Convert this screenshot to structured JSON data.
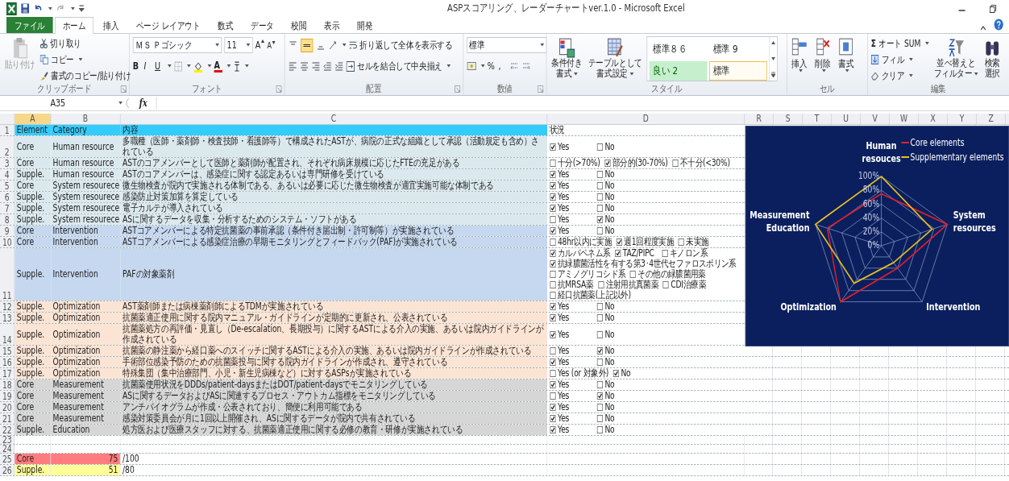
{
  "window": {
    "title": "ASPスコアリング、レーダーチャートver.1.0 - Microsoft Excel"
  },
  "tabs": [
    {
      "label": "ファイル",
      "kind": "file",
      "selected": false
    },
    {
      "label": "ホーム",
      "kind": "tab",
      "selected": true
    },
    {
      "label": "挿入",
      "kind": "tab",
      "selected": false
    },
    {
      "label": "ページ レイアウト",
      "kind": "tab",
      "selected": false
    },
    {
      "label": "数式",
      "kind": "tab",
      "selected": false
    },
    {
      "label": "データ",
      "kind": "tab",
      "selected": false
    },
    {
      "label": "校閲",
      "kind": "tab",
      "selected": false
    },
    {
      "label": "表示",
      "kind": "tab",
      "selected": false
    },
    {
      "label": "開発",
      "kind": "tab",
      "selected": false
    }
  ],
  "ribbon": {
    "clipboard": {
      "paste": "貼り付け",
      "cut": "切り取り",
      "copy": "コピー",
      "format_painter": "書式のコピー/貼り付け",
      "label": "クリップボード"
    },
    "font": {
      "name": "ＭＳ Ｐゴシック",
      "size": "11",
      "grow": "A",
      "shrink": "A",
      "bold": "B",
      "italic": "I",
      "underline": "U",
      "font_color": "A",
      "label": "フォント"
    },
    "alignment": {
      "wrap": "折り返して全体を表示する",
      "merge": "セルを結合して中央揃え",
      "label": "配置"
    },
    "number": {
      "format": "標準",
      "percent": "%",
      "comma": ",",
      "label": "数値"
    },
    "styles": {
      "conditional": [
        "条件付き",
        "書式"
      ],
      "table": [
        "テーブルとして",
        "書式設定"
      ],
      "gallery": [
        {
          "label": "標準８６",
          "kind": "plain",
          "selected": false
        },
        {
          "label": "標準 9",
          "kind": "plain",
          "selected": false
        },
        {
          "label": "良い 2",
          "kind": "good",
          "selected": false
        },
        {
          "label": "標準",
          "kind": "plain",
          "selected": true
        }
      ],
      "label": "スタイル"
    },
    "cells": {
      "buttons": [
        "挿入",
        "削除",
        "書式"
      ],
      "label": "セル"
    },
    "editing": {
      "sigma": "Σ",
      "autosum": "オート SUM",
      "fill": "フィル",
      "clear": "クリア",
      "sort": [
        "並べ替えと",
        "フィルター"
      ],
      "find": [
        "検索",
        "選択"
      ],
      "label": "編集"
    }
  },
  "formula_bar": {
    "name_box": "A35",
    "fx": "fx"
  },
  "sheet": {
    "columns": [
      {
        "label": "A",
        "selected": true
      },
      {
        "label": "B",
        "selected": false
      },
      {
        "label": "C",
        "selected": false
      },
      {
        "label": "D",
        "selected": false
      },
      {
        "label": "R",
        "selected": false
      },
      {
        "label": "S",
        "selected": false
      },
      {
        "label": "T",
        "selected": false
      },
      {
        "label": "U",
        "selected": false
      },
      {
        "label": "V",
        "selected": false
      },
      {
        "label": "W",
        "selected": false
      },
      {
        "label": "X",
        "selected": false
      },
      {
        "label": "Y",
        "selected": false
      },
      {
        "label": "Z",
        "selected": false
      }
    ],
    "rows": [
      {
        "number": "1",
        "kind": "header",
        "element": "Element",
        "category": "Category",
        "content": "内容",
        "status": "状況"
      },
      {
        "number": "2",
        "kind": "item",
        "color": "#dbe9ef",
        "element": "Core",
        "category": "Human resource",
        "content": "多職種（医師・薬剤師・検査技師・看護師等）で構成されたASTが、病院の正式な組織として承認（活動規定も含め）されている",
        "option_lines": [
          [
            {
              "label": "Yes",
              "checked": true
            },
            {
              "label": "No",
              "checked": false
            }
          ]
        ]
      },
      {
        "number": "3",
        "kind": "item",
        "color": "#dbe9ef",
        "element": "Core",
        "category": "Human resource",
        "content": "ASTのコアメンバーとして医師と薬剤師が配置され、それぞれ病床規模に応じたFTEの充足がある",
        "option_lines": [
          [
            {
              "label": "十分(>70%)",
              "checked": false
            },
            {
              "label": "部分的(30-70%)",
              "checked": true
            },
            {
              "label": "不十分(<30%)",
              "checked": false
            }
          ]
        ]
      },
      {
        "number": "4",
        "kind": "item",
        "color": "#dbe9ef",
        "element": "Supple.",
        "category": "Human resource",
        "content": "ASTのコアメンバーは、感染症に関する認定あるいは専門研修を受けている",
        "option_lines": [
          [
            {
              "label": "Yes",
              "checked": true
            },
            {
              "label": "No",
              "checked": false
            }
          ]
        ]
      },
      {
        "number": "5",
        "kind": "item",
        "color": "#dbe9ef",
        "element": "Core",
        "category": "System resourece",
        "content": "微生物検査が院内で実施される体制である、あるいは必要に応じた微生物検査が適宜実施可能な体制である",
        "option_lines": [
          [
            {
              "label": "Yes",
              "checked": true
            },
            {
              "label": "No",
              "checked": false
            }
          ]
        ]
      },
      {
        "number": "6",
        "kind": "item",
        "color": "#dbe9ef",
        "element": "Supple.",
        "category": "System resourece",
        "content": "感染防止対策加算を算定している",
        "option_lines": [
          [
            {
              "label": "Yes",
              "checked": true
            },
            {
              "label": "No",
              "checked": false
            }
          ]
        ]
      },
      {
        "number": "7",
        "kind": "item",
        "color": "#dbe9ef",
        "element": "Supple.",
        "category": "System resourece",
        "content": "電子カルテが導入されている",
        "option_lines": [
          [
            {
              "label": "Yes",
              "checked": true
            },
            {
              "label": "No",
              "checked": false
            }
          ]
        ]
      },
      {
        "number": "8",
        "kind": "item",
        "color": "#dbe9ef",
        "element": "Supple.",
        "category": "System resourece",
        "content": "ASに関するデータを収集・分析するためのシステム・ソフトがある",
        "option_lines": [
          [
            {
              "label": "Yes",
              "checked": false
            },
            {
              "label": "No",
              "checked": true
            }
          ]
        ]
      },
      {
        "number": "9",
        "kind": "item",
        "color": "#c6d8ef",
        "element": "Core",
        "category": "Intervention",
        "content": "ASTコアメンバーによる特定抗菌薬の事前承認（条件付き届出制・許可制等）が実施されている",
        "option_lines": [
          [
            {
              "label": "Yes",
              "checked": true
            },
            {
              "label": "No",
              "checked": false
            }
          ]
        ]
      },
      {
        "number": "10",
        "kind": "item",
        "color": "#c6d8ef",
        "element": "Core",
        "category": "Intervention",
        "content": "ASTコアメンバーによる感染症治療の早期モニタリングとフィードバック(PAF)が実施されている",
        "option_lines": [
          [
            {
              "label": "48hr以内に実施",
              "checked": false
            },
            {
              "label": "週1回程度実施",
              "checked": true
            },
            {
              "label": "未実施",
              "checked": false
            }
          ]
        ]
      },
      {
        "number": "11",
        "kind": "item",
        "color": "#c6d8ef",
        "element": "Supple.",
        "category": "Intervention",
        "content": "PAFの対象薬剤",
        "option_lines": [
          [
            {
              "label": "カルバペネム系",
              "checked": true
            },
            {
              "label": "TAZ/PIPC",
              "checked": true
            },
            {
              "label": "キノロン系",
              "checked": false
            }
          ],
          [
            {
              "label": "抗緑膿菌活性を有する第3･4世代セファロスポリン系",
              "checked": true
            }
          ],
          [
            {
              "label": "アミノグリコシド系",
              "checked": false
            },
            {
              "label": "その他の緑膿菌用薬",
              "checked": false
            }
          ],
          [
            {
              "label": "抗MRSA薬",
              "checked": false
            },
            {
              "label": "注射用抗真菌薬",
              "checked": false
            },
            {
              "label": "CDI治療薬",
              "checked": false
            }
          ],
          [
            {
              "label": "経口抗菌薬(上記以外)",
              "checked": false
            }
          ]
        ]
      },
      {
        "number": "12",
        "kind": "item",
        "color": "#fce4d4",
        "element": "Supple.",
        "category": "Optimization",
        "content": "AST薬剤師または病棟薬剤師によるTDMが実施されている",
        "option_lines": [
          [
            {
              "label": "Yes",
              "checked": true
            },
            {
              "label": "No",
              "checked": false
            }
          ]
        ]
      },
      {
        "number": "13",
        "kind": "item",
        "color": "#fce4d4",
        "element": "Supple.",
        "category": "Optimization",
        "content": "抗菌薬適正使用に関する院内マニュアル・ガイドラインが定期的に更新され、公表されている",
        "option_lines": [
          [
            {
              "label": "Yes",
              "checked": true
            },
            {
              "label": "No",
              "checked": false
            }
          ]
        ]
      },
      {
        "number": "14",
        "kind": "item",
        "color": "#fce4d4",
        "element": "Supple.",
        "category": "Optimization",
        "content": "抗菌薬処方の再評価・見直し（De-escalation、長期投与）に関するASTによる介入の実施、あるいは院内ガイドラインが作成されている",
        "option_lines": [
          [
            {
              "label": "Yes",
              "checked": true
            },
            {
              "label": "No",
              "checked": false
            }
          ]
        ]
      },
      {
        "number": "15",
        "kind": "item",
        "color": "#fce4d4",
        "element": "Supple.",
        "category": "Optimization",
        "content": "抗菌薬の静注薬から経口薬へのスイッチに関するASTによる介入の実施、あるいは院内ガイドラインが作成されている",
        "option_lines": [
          [
            {
              "label": "Yes",
              "checked": false
            },
            {
              "label": "No",
              "checked": true
            }
          ]
        ]
      },
      {
        "number": "16",
        "kind": "item",
        "color": "#fce4d4",
        "element": "Supple.",
        "category": "Optimization",
        "content": "手術部位感染予防のための抗菌薬投与に関する院内ガイドラインが作成され、遵守されている",
        "option_lines": [
          [
            {
              "label": "Yes",
              "checked": true
            },
            {
              "label": "No",
              "checked": false
            }
          ]
        ]
      },
      {
        "number": "17",
        "kind": "item",
        "color": "#fce4d4",
        "element": "Supple.",
        "category": "Optimization",
        "content": "特殊集団（集中治療部門、小児・新生児病棟など）に対するASPsが実施されている",
        "option_lines": [
          [
            {
              "label": "Yes (or 対象外)",
              "checked": false
            },
            {
              "label": "No",
              "checked": true
            }
          ]
        ]
      },
      {
        "number": "18",
        "kind": "item",
        "color": "#d6d6d6",
        "element": "Core",
        "category": "Measurement",
        "content": "抗菌薬使用状況をDDDs/patient-daysまたはDOT/patient-daysでモニタリングしている",
        "option_lines": [
          [
            {
              "label": "Yes",
              "checked": true
            },
            {
              "label": "No",
              "checked": false
            }
          ]
        ]
      },
      {
        "number": "19",
        "kind": "item",
        "color": "#d6d6d6",
        "element": "Core",
        "category": "Measurement",
        "content": "ASに関するデータおよびASに関連するプロセス・アウトカム指標をモニタリングしている",
        "option_lines": [
          [
            {
              "label": "Yes",
              "checked": false
            },
            {
              "label": "No",
              "checked": true
            }
          ]
        ]
      },
      {
        "number": "20",
        "kind": "item",
        "color": "#d6d6d6",
        "element": "Core",
        "category": "Measurement",
        "content": "アンチバイオグラムが作成・公表されており、簡便に利用可能である",
        "option_lines": [
          [
            {
              "label": "Yes",
              "checked": true
            },
            {
              "label": "No",
              "checked": false
            }
          ]
        ]
      },
      {
        "number": "21",
        "kind": "item",
        "color": "#d6d6d6",
        "element": "Core",
        "category": "Measurement",
        "content": "感染対策委員会が月に1回以上開催され、ASに関するデータが院内で共有されている",
        "option_lines": [
          [
            {
              "label": "Yes",
              "checked": true
            },
            {
              "label": "No",
              "checked": false
            }
          ]
        ]
      },
      {
        "number": "22",
        "kind": "item",
        "color": "#d6d6d6",
        "element": "Supple.",
        "category": "Education",
        "content": "処方医および医療スタッフに対する、抗菌薬適正使用に関する必修の教育・研修が実施されている",
        "option_lines": [
          [
            {
              "label": "Yes",
              "checked": true
            },
            {
              "label": "No",
              "checked": false
            }
          ]
        ]
      },
      {
        "number": "23",
        "kind": "blank"
      },
      {
        "number": "24",
        "kind": "blank"
      },
      {
        "number": "25",
        "kind": "total",
        "label": "Core",
        "score": "75",
        "max": "/100",
        "color": "#ff7c80"
      },
      {
        "number": "26",
        "kind": "total",
        "label": "Supple.",
        "score": "51",
        "max": "/80",
        "color": "#ffff99"
      }
    ]
  },
  "chart": {
    "chart_data": {
      "type": "radar",
      "categories": [
        "Human resouces",
        "System resources",
        "Intervention",
        "Optimization",
        "Measurement Education"
      ],
      "series": [
        {
          "name": "Core elements",
          "color": "#e0202a",
          "values": [
            75,
            100,
            40,
            100,
            82
          ]
        },
        {
          "name": "Supplementary elements",
          "color": "#e8c020",
          "values": [
            100,
            77,
            30,
            67,
            100
          ]
        }
      ],
      "legend": "top right",
      "ylim": [
        0,
        100
      ],
      "yticks": [
        {
          "value": 0,
          "label": "0%"
        },
        {
          "value": 20,
          "label": "20%"
        },
        {
          "value": 40,
          "label": "40%"
        },
        {
          "value": 60,
          "label": "60%"
        },
        {
          "value": 80,
          "label": "80%"
        },
        {
          "value": 100,
          "label": "100%"
        }
      ]
    }
  }
}
